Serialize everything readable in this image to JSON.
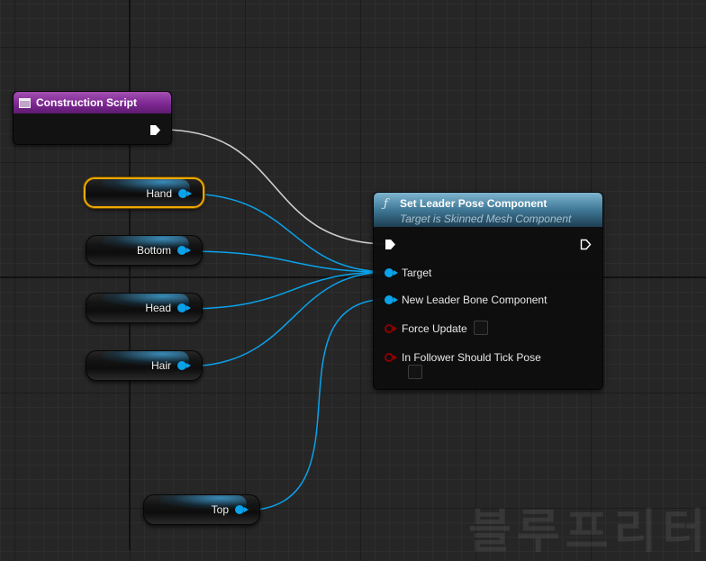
{
  "event_node": {
    "title": "Construction Script",
    "icon": "event-graph-icon"
  },
  "variables": {
    "hand": "Hand",
    "bottom": "Bottom",
    "head": "Head",
    "hair": "Hair",
    "top": "Top"
  },
  "function_node": {
    "icon": "ƒ",
    "title": "Set Leader Pose Component",
    "subtitle": "Target is Skinned Mesh Component",
    "pins": {
      "target": "Target",
      "new_leader": "New Leader Bone Component",
      "force_update": "Force Update",
      "follower_tick": "In Follower Should Tick Pose"
    }
  },
  "colors": {
    "object_pin": "#0aa2ea",
    "bool_pin": "#8c0000",
    "exec_wire": "#cfcfcf",
    "event_header": "#7a2590",
    "function_header": "#3f7896",
    "selection": "#f1a800"
  },
  "watermark": "블루프리터"
}
